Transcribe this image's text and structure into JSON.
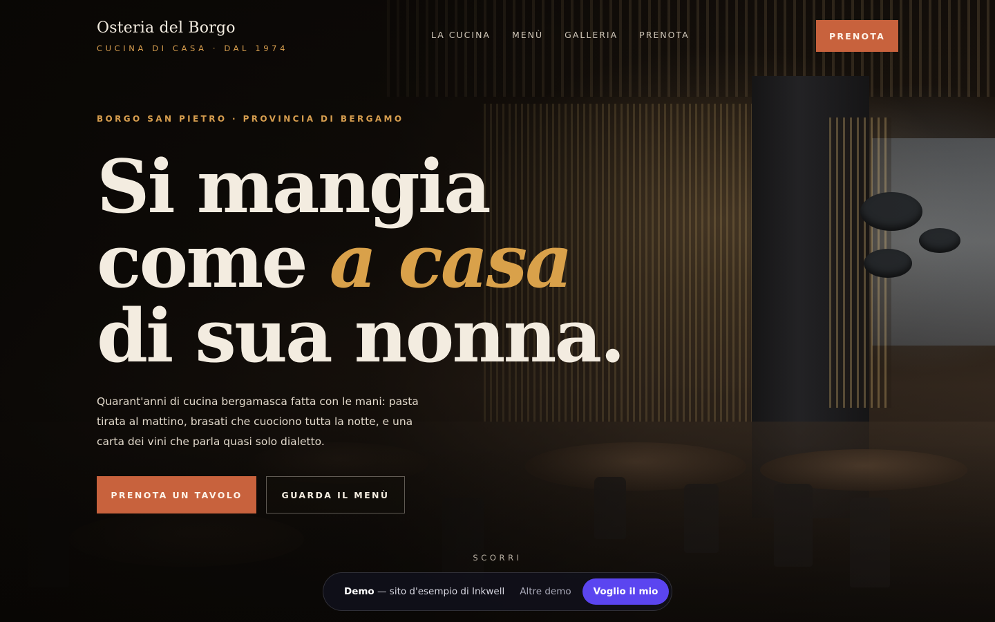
{
  "header": {
    "brand_name": "Osteria del Borgo",
    "brand_tagline": "CUCINA DI CASA · DAL 1974",
    "nav": [
      {
        "label": "LA CUCINA"
      },
      {
        "label": "MENÙ"
      },
      {
        "label": "GALLERIA"
      },
      {
        "label": "PRENOTA"
      }
    ],
    "cta_label": "PRENOTA"
  },
  "hero": {
    "eyebrow": "BORGO SAN PIETRO · PROVINCIA DI BERGAMO",
    "headline_line1": "Si mangia",
    "headline_line2_start": "come ",
    "headline_line2_accent": "a casa",
    "headline_line3": "di sua nonna.",
    "lead": "Quarant'anni di cucina bergamasca fatta con le mani: pasta tirata al mattino, brasati che cuociono tutta la notte, e una carta dei vini che parla quasi solo dialetto.",
    "primary_button": "PRENOTA UN TAVOLO",
    "secondary_button": "GUARDA IL MENÙ",
    "scroll_hint": "SCORRI"
  },
  "demo_bar": {
    "icon": "drop-icon",
    "label_strong": "Demo",
    "label_rest": " — sito d'esempio di Inkwell",
    "link_label": "Altre demo",
    "cta_label": "Voglio il mio"
  },
  "colors": {
    "accent": "#c8623d",
    "gold": "#d79e4f",
    "demo_cta": "#5b45f0"
  }
}
